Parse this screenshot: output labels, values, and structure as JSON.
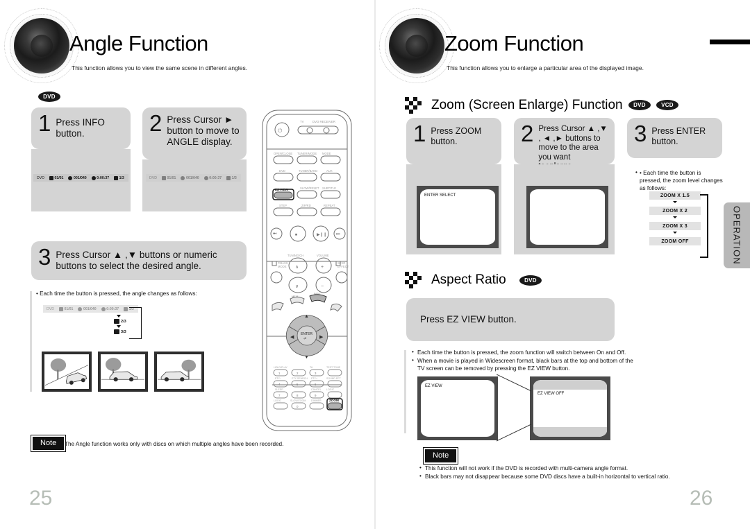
{
  "left_page": {
    "chapter_title": "Angle Function",
    "chapter_desc": "This function allows you to view the same scene in different angles.",
    "media_badge": "DVD",
    "steps": [
      {
        "num": "1",
        "text": "Press INFO button."
      },
      {
        "num": "2",
        "text": "Press Cursor ► button to move to ANGLE display."
      },
      {
        "num": "3",
        "text": "Press Cursor ▲ ,▼  buttons or numeric buttons to select the desired angle."
      }
    ],
    "osd_step1": {
      "disc": "DVD",
      "title": "01/01",
      "chapter": "001/040",
      "time": "0:00:37",
      "angle": "1/3"
    },
    "osd_step2": {
      "disc": "DVD",
      "title": "01/01",
      "chapter": "001/040",
      "time": "0:00:37",
      "angle": "1/3"
    },
    "cycle_note": "• Each time the button is pressed, the angle changes as follows:",
    "angle_cycle": [
      "1/3",
      "2/3",
      "3/3"
    ],
    "note_label": "Note",
    "note_text": "• The Angle function works only with discs on which multiple angles have been recorded.",
    "page_number": "25"
  },
  "right_page": {
    "chapter_title": "Zoom Function",
    "chapter_desc": "This function allows you to enlarge a particular area of the displayed image.",
    "zoom_section": {
      "title": "Zoom (Screen Enlarge) Function",
      "badges": [
        "DVD",
        "VCD"
      ],
      "steps": [
        {
          "num": "1",
          "text": "Press ZOOM button."
        },
        {
          "num": "2",
          "text": "Press Cursor ▲ ,▼ , ◄ ,► buttons to move to the area you want toenlarge."
        },
        {
          "num": "3",
          "text": "Press ENTER button."
        }
      ],
      "tv1_label": "ENTER SELECT",
      "tv2_label": "",
      "level_note": "• Each time the button is pressed, the zoom level changes as follows:",
      "zoom_levels": [
        "ZOOM X 1.5",
        "ZOOM X 2",
        "ZOOM X 3",
        "ZOOM OFF"
      ]
    },
    "aspect_section": {
      "title": "Aspect Ratio",
      "badge": "DVD",
      "instruction": "Press EZ VIEW button.",
      "bullets": [
        "Each time the button is pressed, the zoom function will switch between On and Off.",
        "When a movie is played in Widescreen format, black bars at the top and bottom of the TV screen can be removed by pressing the EZ VIEW button."
      ],
      "tv_on_label": "EZ VIEW",
      "tv_off_label": "EZ VIEW OFF"
    },
    "note_label": "Note",
    "note_bullets": [
      "This function will not work if the DVD is recorded with multi-camera angle format.",
      "Black bars may not disappear because some DVD discs have a built-in horizontal to vertical ratio."
    ],
    "side_tab": "OPERATION",
    "page_number": "26"
  },
  "remote": {
    "labels": {
      "power": "power-icon",
      "device_tv": "TV",
      "device_dvd": "DVD RECEIVER",
      "open_close": "OPEN/CLOSE",
      "tuner_mode": "TUNER/MODE",
      "mode": "MODE",
      "dvd": "DVD",
      "tuner_band": "TUNER/BAND",
      "aux": "AUX",
      "ez_view": "EZ VIEW",
      "slow_reset": "SLOW/RESET",
      "subtitle": "SUBTITLE",
      "step": "STEP",
      "zoom_top": "ZOOMED",
      "repeat": "REPEAT",
      "enter": "ENTER",
      "zoom": "ZOOM"
    },
    "highlighted": [
      "EZ VIEW",
      "ZOOM"
    ]
  }
}
